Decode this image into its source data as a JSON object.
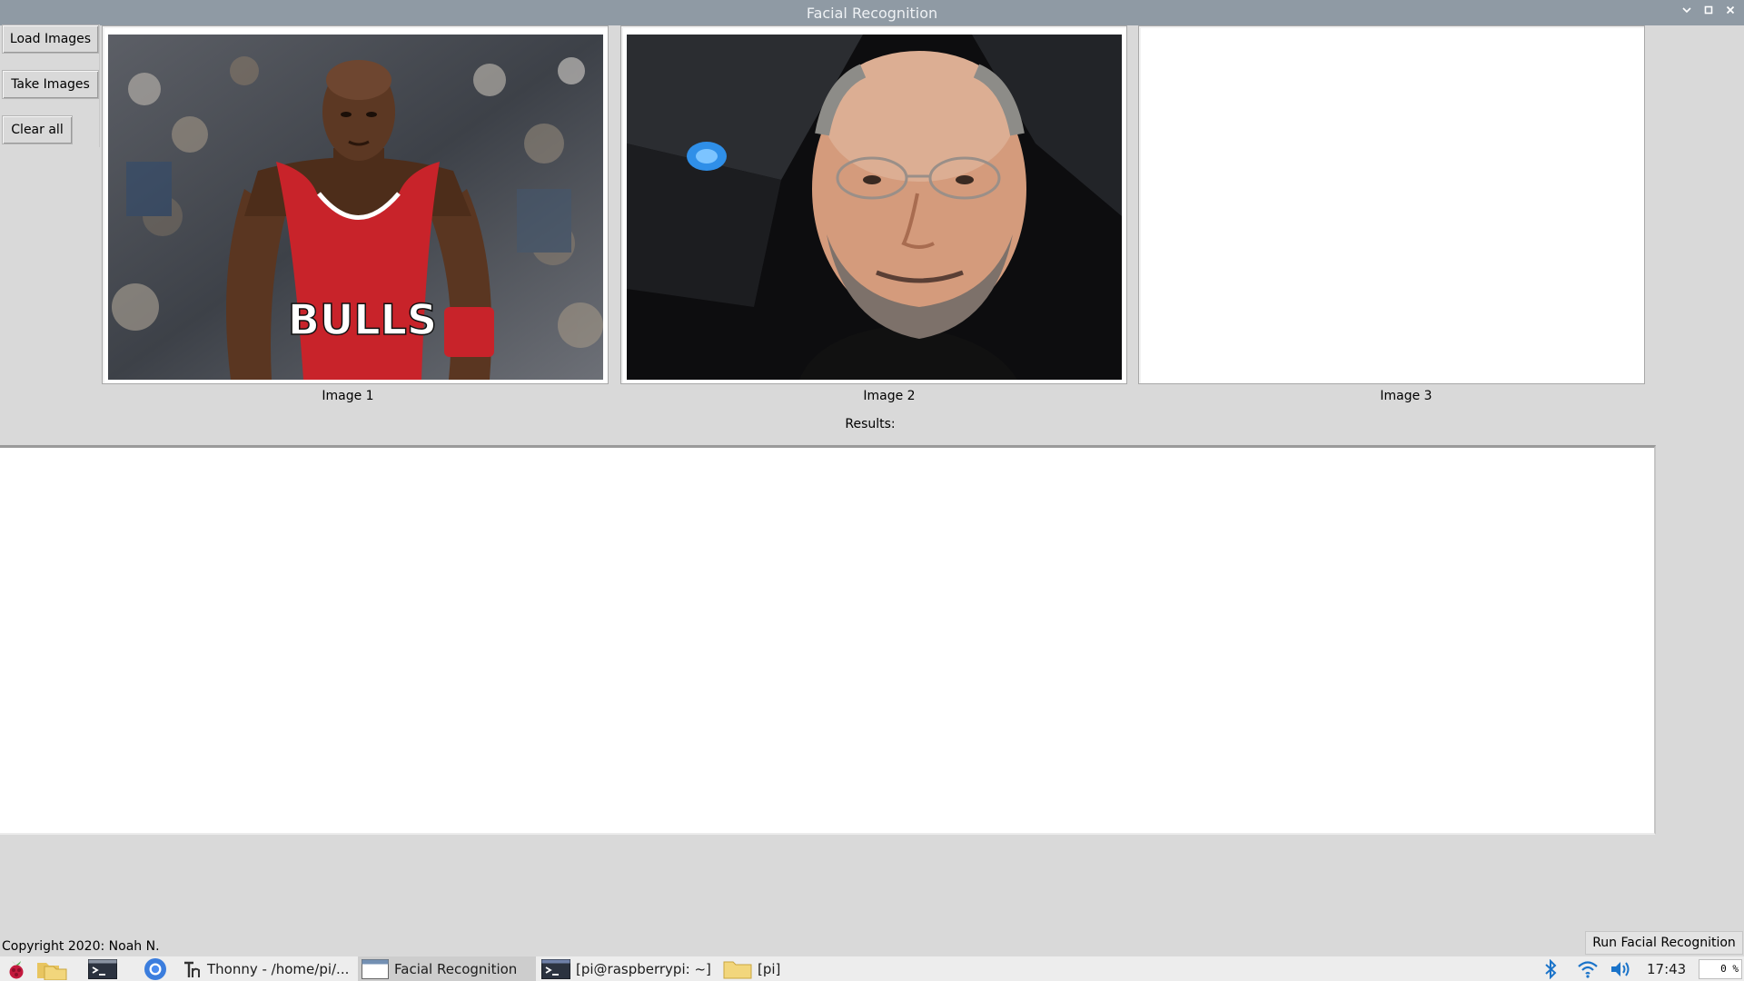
{
  "window": {
    "title": "Facial Recognition",
    "controls": [
      "chevron-down-icon",
      "maximize-icon",
      "close-icon"
    ]
  },
  "buttons": {
    "load_images": "Load Images",
    "take_images": "Take Images",
    "clear_all": "Clear all",
    "run": "Run Facial Recognition"
  },
  "images": [
    {
      "caption": "Image 1"
    },
    {
      "caption": "Image 2"
    },
    {
      "caption": "Image 3"
    }
  ],
  "results": {
    "label": "Results:",
    "text": ""
  },
  "footer": {
    "copyright": "Copyright 2020: Noah N."
  },
  "taskbar": {
    "tasks": [
      {
        "label": "Thonny  -  /home/pi/...",
        "icon": "thonny-icon"
      },
      {
        "label": "Facial Recognition",
        "icon": "window-icon"
      },
      {
        "label": "[pi@raspberrypi: ~]",
        "icon": "terminal-icon"
      },
      {
        "label": "[pi]",
        "icon": "folder-icon"
      }
    ],
    "clock": "17:43",
    "cpu": "0 %"
  },
  "colors": {
    "titlebar": "#8f9aa4",
    "window_bg": "#d9d9d9",
    "jersey_red": "#c8232a",
    "taskbar_bg": "#ededed",
    "tray_blue": "#1a73c9"
  }
}
